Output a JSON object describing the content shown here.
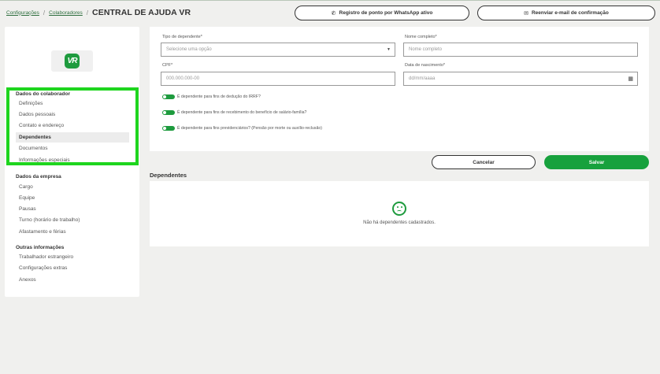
{
  "header": {
    "breadcrumb": [
      "Configurações",
      "Colaboradores"
    ],
    "separator": "/",
    "title": "CENTRAL DE AJUDA VR",
    "whatsapp_button": "Registro de ponto por WhatsApp ativo",
    "email_button": "Reenviar e-mail de confirmação"
  },
  "sidebar": {
    "logo_text": "VR",
    "sections": [
      {
        "title": "Dados do colaborador",
        "items": [
          "Definições",
          "Dados pessoais",
          "Contato e endereço",
          "Dependentes",
          "Documentos",
          "Informações especiais"
        ]
      },
      {
        "title": "Dados da empresa",
        "items": [
          "Cargo",
          "Equipe",
          "Pausas",
          "Turno (horário de trabalho)",
          "Afastamento e férias"
        ]
      },
      {
        "title": "Outras informações",
        "items": [
          "Trabalhador estrangeiro",
          "Configurações extras",
          "Anexos"
        ]
      }
    ],
    "active_item": "Dependentes",
    "highlight_color": "#1ed51e"
  },
  "form": {
    "dependent_type": {
      "label": "Tipo de dependente*",
      "placeholder": "Selecione uma opção"
    },
    "full_name": {
      "label": "Nome completo*",
      "placeholder": "Nome completo"
    },
    "cpf": {
      "label": "CPF*",
      "placeholder": "000.000.000-00"
    },
    "birth_date": {
      "label": "Data de nascimento*",
      "placeholder": "dd/mm/aaaa"
    },
    "toggles": [
      "É dependente para fins de dedução do IRRF?",
      "É dependente para fins de recebimento do benefício de salário-família?",
      "É dependente para fins previdenciários? (Pensão por morte ou auxílio-reclusão)"
    ]
  },
  "actions": {
    "cancel": "Cancelar",
    "save": "Salvar"
  },
  "dependents": {
    "title": "Dependentes",
    "empty_message": "Não há dependentes cadastrados."
  },
  "colors": {
    "brand_green": "#1e9b3e",
    "save_green": "#17a13d"
  }
}
